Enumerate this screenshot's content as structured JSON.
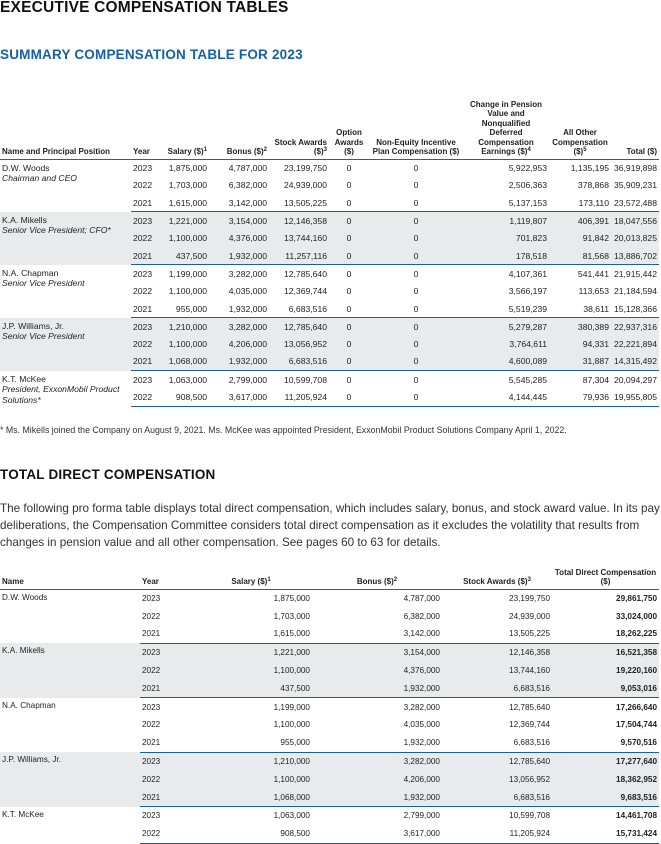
{
  "page_title": "EXECUTIVE COMPENSATION TABLES",
  "summary": {
    "title": "SUMMARY COMPENSATION TABLE FOR 2023",
    "columns": [
      {
        "label": "Name and Principal Position",
        "sup": ""
      },
      {
        "label": "Year",
        "sup": ""
      },
      {
        "label": "Salary ($)",
        "sup": "1"
      },
      {
        "label": "Bonus ($)",
        "sup": "2"
      },
      {
        "label": "Stock Awards ($)",
        "sup": "3"
      },
      {
        "label": "Option Awards ($)",
        "sup": ""
      },
      {
        "label": "Non-Equity Incentive Plan Compensation ($)",
        "sup": ""
      },
      {
        "label": "Change in Pension Value and Nonqualified Deferred Compensation Earnings ($)",
        "sup": "4"
      },
      {
        "label": "All Other Compensation ($)",
        "sup": "5"
      },
      {
        "label": "Total ($)",
        "sup": ""
      }
    ],
    "people": [
      {
        "name": "D.W. Woods",
        "title": "Chairman and CEO",
        "rows": [
          [
            "2023",
            "1,875,000",
            "4,787,000",
            "23,199,750",
            "0",
            "0",
            "5,922,953",
            "1,135,195",
            "36,919,898"
          ],
          [
            "2022",
            "1,703,000",
            "6,382,000",
            "24,939,000",
            "0",
            "0",
            "2,506,363",
            "378,868",
            "35,909,231"
          ],
          [
            "2021",
            "1,615,000",
            "3,142,000",
            "13,505,225",
            "0",
            "0",
            "5,137,153",
            "173,110",
            "23,572,488"
          ]
        ]
      },
      {
        "name": "K.A. Mikells",
        "title": "Senior Vice President; CFO*",
        "rows": [
          [
            "2023",
            "1,221,000",
            "3,154,000",
            "12,146,358",
            "0",
            "0",
            "1,119,807",
            "406,391",
            "18,047,556"
          ],
          [
            "2022",
            "1,100,000",
            "4,376,000",
            "13,744,160",
            "0",
            "0",
            "701,823",
            "91,842",
            "20,013,825"
          ],
          [
            "2021",
            "437,500",
            "1,932,000",
            "11,257,116",
            "0",
            "0",
            "178,518",
            "81,568",
            "13,886,702"
          ]
        ]
      },
      {
        "name": "N.A. Chapman",
        "title": "Senior Vice President",
        "rows": [
          [
            "2023",
            "1,199,000",
            "3,282,000",
            "12,785,640",
            "0",
            "0",
            "4,107,361",
            "541,441",
            "21,915,442"
          ],
          [
            "2022",
            "1,100,000",
            "4,035,000",
            "12,369,744",
            "0",
            "0",
            "3,566,197",
            "113,653",
            "21,184,594"
          ],
          [
            "2021",
            "955,000",
            "1,932,000",
            "6,683,516",
            "0",
            "0",
            "5,519,239",
            "38,611",
            "15,128,366"
          ]
        ]
      },
      {
        "name": "J.P. Williams, Jr.",
        "title": "Senior Vice President",
        "rows": [
          [
            "2023",
            "1,210,000",
            "3,282,000",
            "12,785,640",
            "0",
            "0",
            "5,279,287",
            "380,389",
            "22,937,316"
          ],
          [
            "2022",
            "1,100,000",
            "4,206,000",
            "13,056,952",
            "0",
            "0",
            "3,764,611",
            "94,331",
            "22,221,894"
          ],
          [
            "2021",
            "1,068,000",
            "1,932,000",
            "6,683,516",
            "0",
            "0",
            "4,600,089",
            "31,887",
            "14,315,492"
          ]
        ]
      },
      {
        "name": "K.T. McKee",
        "title": "President, ExxonMobil Product Solutions*",
        "rows": [
          [
            "2023",
            "1,063,000",
            "2,799,000",
            "10,599,708",
            "0",
            "0",
            "5,545,285",
            "87,304",
            "20,094,297"
          ],
          [
            "2022",
            "908,500",
            "3,617,000",
            "11,205,924",
            "0",
            "0",
            "4,144,445",
            "79,936",
            "19,955,805"
          ]
        ]
      }
    ],
    "footnote": "* Ms. Mikells joined the Company on August 9, 2021. Ms. McKee was appointed President, ExxonMobil Product Solutions Company April 1, 2022."
  },
  "tdc": {
    "title": "TOTAL DIRECT COMPENSATION",
    "intro": "The following pro forma table displays total direct compensation, which includes salary, bonus, and stock award value. In its pay deliberations, the Compensation Committee considers total direct compensation as it excludes the volatility that results from changes in pension value and all other compensation. See pages 60 to 63 for details.",
    "columns": [
      {
        "label": "Name",
        "sup": ""
      },
      {
        "label": "Year",
        "sup": ""
      },
      {
        "label": "Salary ($)",
        "sup": "1"
      },
      {
        "label": "Bonus ($)",
        "sup": "2"
      },
      {
        "label": "Stock Awards ($)",
        "sup": "3"
      },
      {
        "label": "Total Direct Compensation ($)",
        "sup": ""
      }
    ],
    "people": [
      {
        "name": "D.W. Woods",
        "rows": [
          [
            "2023",
            "1,875,000",
            "4,787,000",
            "23,199,750",
            "29,861,750"
          ],
          [
            "2022",
            "1,703,000",
            "6,382,000",
            "24,939,000",
            "33,024,000"
          ],
          [
            "2021",
            "1,615,000",
            "3,142,000",
            "13,505,225",
            "18,262,225"
          ]
        ]
      },
      {
        "name": "K.A. Mikells",
        "rows": [
          [
            "2023",
            "1,221,000",
            "3,154,000",
            "12,146,358",
            "16,521,358"
          ],
          [
            "2022",
            "1,100,000",
            "4,376,000",
            "13,744,160",
            "19,220,160"
          ],
          [
            "2021",
            "437,500",
            "1,932,000",
            "6,683,516",
            "9,053,016"
          ]
        ]
      },
      {
        "name": "N.A. Chapman",
        "rows": [
          [
            "2023",
            "1,199,000",
            "3,282,000",
            "12,785,640",
            "17,266,640"
          ],
          [
            "2022",
            "1,100,000",
            "4,035,000",
            "12,369,744",
            "17,504,744"
          ],
          [
            "2021",
            "955,000",
            "1,932,000",
            "6,683,516",
            "9,570,516"
          ]
        ]
      },
      {
        "name": "J.P. Williams, Jr.",
        "rows": [
          [
            "2023",
            "1,210,000",
            "3,282,000",
            "12,785,640",
            "17,277,640"
          ],
          [
            "2022",
            "1,100,000",
            "4,206,000",
            "13,056,952",
            "18,362,952"
          ],
          [
            "2021",
            "1,068,000",
            "1,932,000",
            "6,683,516",
            "9,683,516"
          ]
        ]
      },
      {
        "name": "K.T. McKee",
        "rows": [
          [
            "2023",
            "1,063,000",
            "2,799,000",
            "10,599,708",
            "14,461,708"
          ],
          [
            "2022",
            "908,500",
            "3,617,000",
            "11,205,924",
            "15,731,424"
          ]
        ]
      }
    ]
  }
}
